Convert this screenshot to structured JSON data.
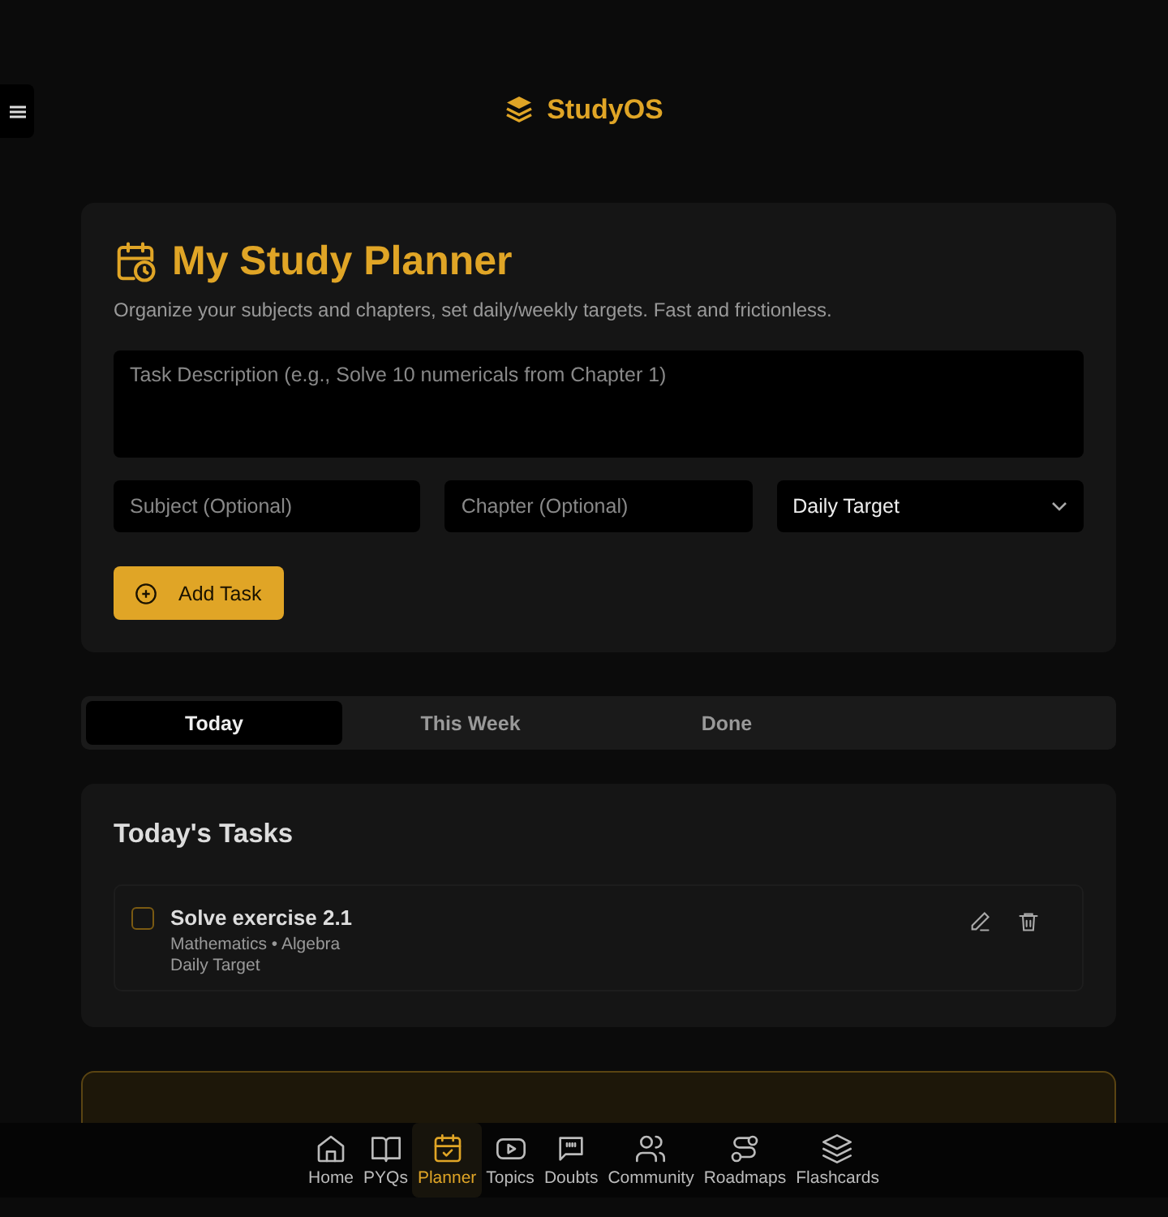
{
  "app": {
    "name": "StudyOS"
  },
  "planner": {
    "title": "My Study Planner",
    "subtitle": "Organize your subjects and chapters, set daily/weekly targets. Fast and frictionless.",
    "task_field": {
      "placeholder": "Task Description (e.g., Solve 10 numericals from Chapter 1)"
    },
    "subject_field": {
      "placeholder": "Subject (Optional)"
    },
    "chapter_field": {
      "placeholder": "Chapter (Optional)"
    },
    "target_select": {
      "value": "Daily Target"
    },
    "add_button": "Add Task"
  },
  "tabs": [
    {
      "label": "Today",
      "selected": true
    },
    {
      "label": "This Week",
      "selected": false
    },
    {
      "label": "Done",
      "selected": false
    }
  ],
  "task_list": {
    "title": "Today's Tasks",
    "tasks": [
      {
        "title": "Solve exercise 2.1",
        "meta": "Mathematics • Algebra",
        "target": "Daily Target",
        "checked": false
      }
    ]
  },
  "promo": {
    "kind": "card"
  },
  "bottom_nav": [
    {
      "label": "Home",
      "kind": "home",
      "selected": false
    },
    {
      "label": "PYQs",
      "kind": "book",
      "selected": false
    },
    {
      "label": "Planner",
      "kind": "calendar",
      "selected": true
    },
    {
      "label": "Topics",
      "kind": "play",
      "selected": false
    },
    {
      "label": "Doubts",
      "kind": "chat",
      "selected": false
    },
    {
      "label": "Community",
      "kind": "users",
      "selected": false
    },
    {
      "label": "Roadmaps",
      "kind": "route",
      "selected": false
    },
    {
      "label": "Flashcards",
      "kind": "layers",
      "selected": false
    }
  ]
}
